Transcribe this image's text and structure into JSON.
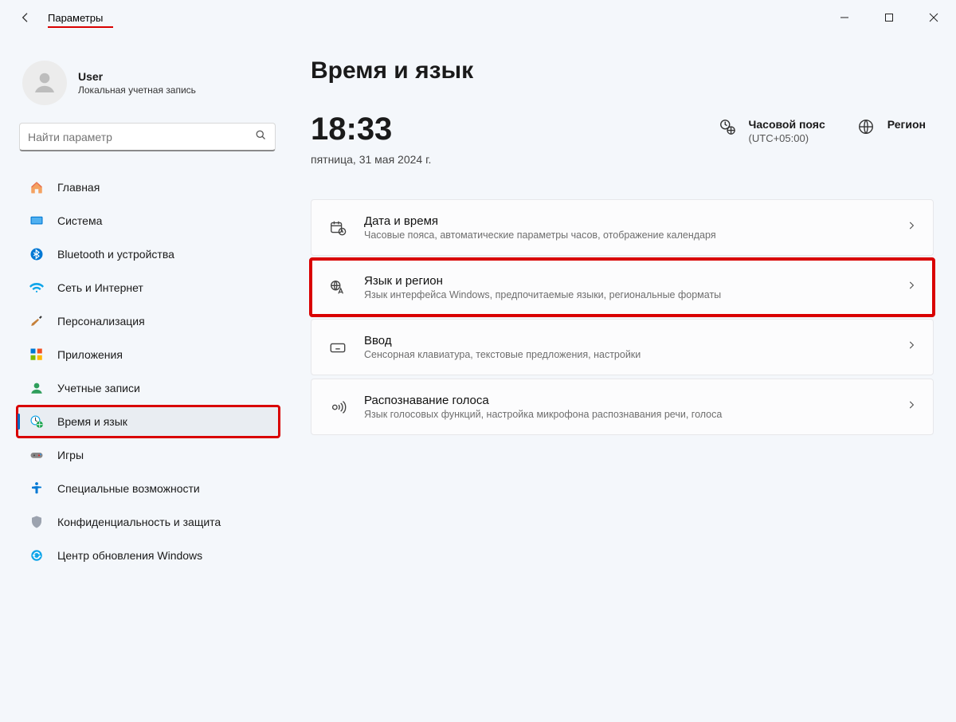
{
  "titlebar": {
    "app_name": "Параметры"
  },
  "account": {
    "name": "User",
    "subtitle": "Локальная учетная запись"
  },
  "search": {
    "placeholder": "Найти параметр"
  },
  "sidebar": {
    "items": [
      {
        "label": "Главная"
      },
      {
        "label": "Система"
      },
      {
        "label": "Bluetooth и устройства"
      },
      {
        "label": "Сеть и Интернет"
      },
      {
        "label": "Персонализация"
      },
      {
        "label": "Приложения"
      },
      {
        "label": "Учетные записи"
      },
      {
        "label": "Время и язык"
      },
      {
        "label": "Игры"
      },
      {
        "label": "Специальные возможности"
      },
      {
        "label": "Конфиденциальность и защита"
      },
      {
        "label": "Центр обновления Windows"
      }
    ]
  },
  "page": {
    "title": "Время и язык",
    "clock_time": "18:33",
    "clock_date": "пятница, 31 мая 2024 г.",
    "timezone_label": "Часовой пояс",
    "timezone_value": "(UTC+05:00)",
    "region_label": "Регион"
  },
  "cards": [
    {
      "title": "Дата и время",
      "subtitle": "Часовые пояса, автоматические параметры часов, отображение календаря"
    },
    {
      "title": "Язык и регион",
      "subtitle": "Язык интерфейса Windows, предпочитаемые языки, региональные форматы"
    },
    {
      "title": "Ввод",
      "subtitle": "Сенсорная клавиатура, текстовые предложения, настройки"
    },
    {
      "title": "Распознавание голоса",
      "subtitle": "Язык голосовых функций, настройка микрофона распознавания речи, голоса"
    }
  ]
}
